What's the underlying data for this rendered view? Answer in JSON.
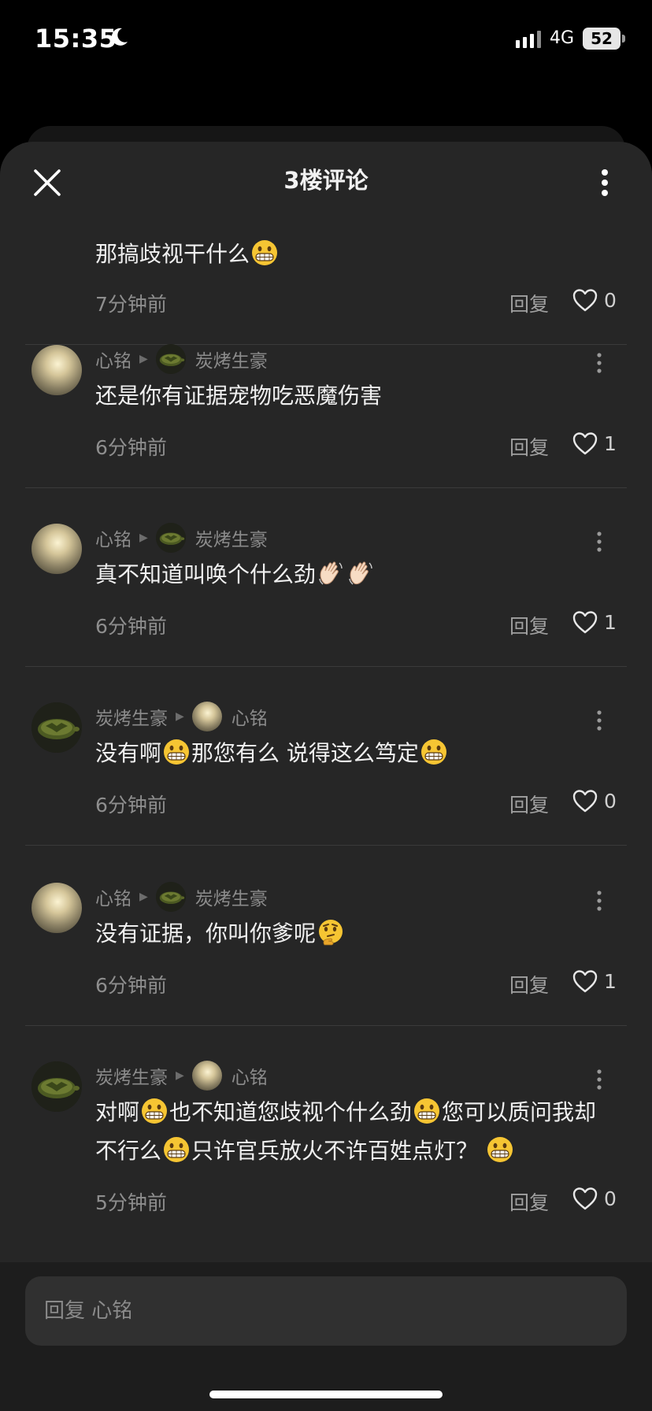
{
  "status": {
    "time": "15:35",
    "network": "4G",
    "battery": "52"
  },
  "header": {
    "title": "3楼评论"
  },
  "partial_comment": {
    "segments": [
      {
        "t": "那搞歧视干什么"
      },
      {
        "e": "grin"
      }
    ],
    "time": "7分钟前",
    "likes": "0"
  },
  "comments": [
    {
      "author": "心铭",
      "author_avatar": "moon",
      "target": "炭烤生豪",
      "target_avatar": "turtle",
      "segments": [
        {
          "t": "还是你有证据宠物吃恶魔伤害"
        }
      ],
      "time": "6分钟前",
      "likes": "1"
    },
    {
      "author": "心铭",
      "author_avatar": "moon",
      "target": "炭烤生豪",
      "target_avatar": "turtle",
      "segments": [
        {
          "t": "真不知道叫唤个什么劲"
        },
        {
          "e": "wave"
        },
        {
          "e": "wave"
        }
      ],
      "time": "6分钟前",
      "likes": "1"
    },
    {
      "author": "炭烤生豪",
      "author_avatar": "turtle",
      "target": "心铭",
      "target_avatar": "moon",
      "segments": [
        {
          "t": "没有啊"
        },
        {
          "e": "grin"
        },
        {
          "t": "那您有么 说得这么笃定"
        },
        {
          "e": "grin"
        }
      ],
      "time": "6分钟前",
      "likes": "0"
    },
    {
      "author": "心铭",
      "author_avatar": "moon",
      "target": "炭烤生豪",
      "target_avatar": "turtle",
      "segments": [
        {
          "t": "没有证据，你叫你爹呢"
        },
        {
          "e": "thinking"
        }
      ],
      "time": "6分钟前",
      "likes": "1"
    },
    {
      "author": "炭烤生豪",
      "author_avatar": "turtle",
      "target": "心铭",
      "target_avatar": "moon",
      "segments": [
        {
          "t": "对啊"
        },
        {
          "e": "grin"
        },
        {
          "t": "也不知道您歧视个什么劲"
        },
        {
          "e": "grin"
        },
        {
          "t": "您可以质问我却不行么"
        },
        {
          "e": "grin"
        },
        {
          "t": "只许官兵放火不许百姓点灯？ "
        },
        {
          "e": "grin"
        }
      ],
      "time": "5分钟前",
      "likes": "0"
    }
  ],
  "labels": {
    "reply": "回复"
  },
  "input": {
    "placeholder": "回复 心铭"
  },
  "icons": {
    "close": "close-icon",
    "more": "more-vertical-icon",
    "like": "heart-outline-icon",
    "moon": "moon-icon",
    "signal": "signal-icon"
  },
  "colors": {
    "background": "#262626",
    "text": "#f0f0f0",
    "muted": "#8b8b8b",
    "emoji": "#f6c533"
  }
}
